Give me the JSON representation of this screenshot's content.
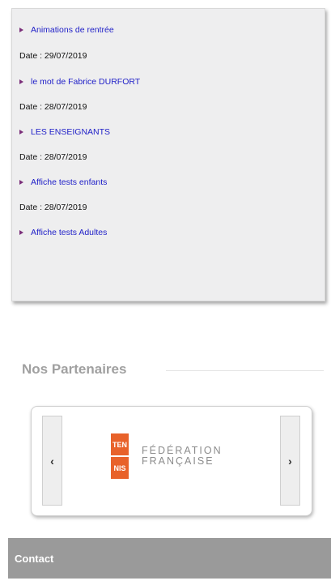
{
  "news": {
    "items": [
      {
        "title": "Animations de rentrée",
        "date": "Date : 29/07/2019"
      },
      {
        "title": "le mot de Fabrice DURFORT",
        "date": "Date : 28/07/2019"
      },
      {
        "title": "LES ENSEIGNANTS",
        "date": "Date : 28/07/2019"
      },
      {
        "title": "Affiche tests enfants",
        "date": "Date : 28/07/2019"
      },
      {
        "title": "Affiche tests Adultes"
      }
    ]
  },
  "partners": {
    "title": "Nos Partenaires",
    "prev_label": "‹",
    "next_label": "›",
    "logo": {
      "mark_lines": [
        "TEN",
        "NIS"
      ],
      "text_lines": [
        "FÉDÉRATION",
        "FRANÇAISE"
      ],
      "colors": {
        "mark": "#e8622a",
        "text": "#8c8c8c"
      }
    }
  },
  "contact": {
    "label": "Contact"
  }
}
